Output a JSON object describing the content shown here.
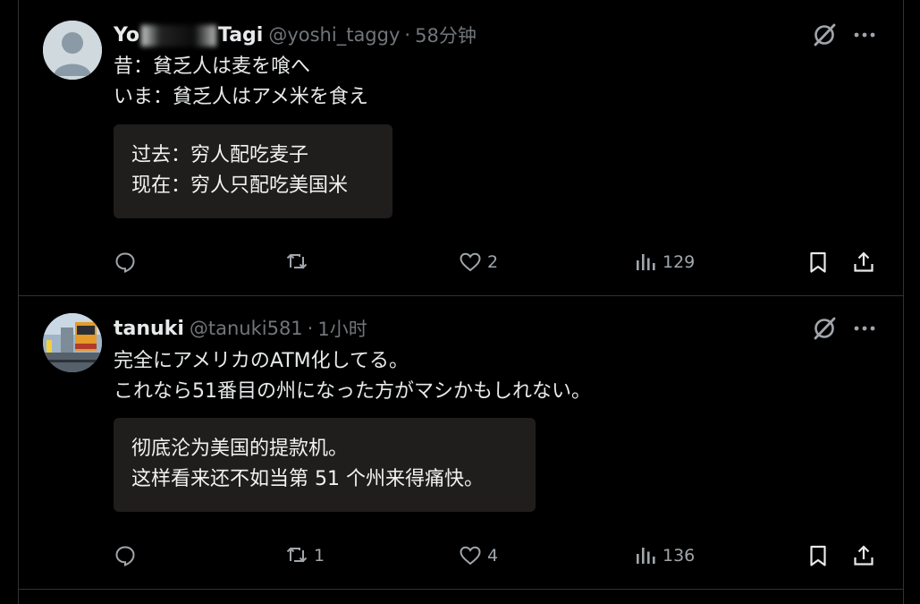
{
  "posts": [
    {
      "name_start": "Yo",
      "name_end": "Tagi",
      "handle": "@yoshi_taggy",
      "separator": "·",
      "time": "58分钟",
      "lines": [
        "昔：貧乏人は麦を喰へ",
        "いま：貧乏人はアメ米を食え"
      ],
      "translation": [
        "过去：穷人配吃麦子",
        "现在：穷人只配吃美国米"
      ],
      "retweets": "",
      "likes": "2",
      "views": "129",
      "avatar": "default-avatar"
    },
    {
      "name": "tanuki",
      "handle": "@tanuki581",
      "separator": "·",
      "time": "1小时",
      "lines": [
        "完全にアメリカのATM化してる。",
        "これなら51番目の州になった方がマシかもしれない。"
      ],
      "translation": [
        "彻底沦为美国的提款机。",
        "这样看来还不如当第 51 个州来得痛快。"
      ],
      "retweets": "1",
      "likes": "4",
      "views": "136",
      "avatar": "train-photo"
    }
  ],
  "icons": {
    "reply": "reply-icon",
    "retweet": "retweet-icon",
    "like": "heart-icon",
    "views": "views-icon",
    "bookmark": "bookmark-icon",
    "share": "share-icon",
    "grok": "grok-icon",
    "more": "more-icon"
  },
  "colors": {
    "background": "#000000",
    "text": "#e7e9ea",
    "muted": "#71767b",
    "divider": "#2f3336",
    "translation_box": "#201d1d"
  }
}
